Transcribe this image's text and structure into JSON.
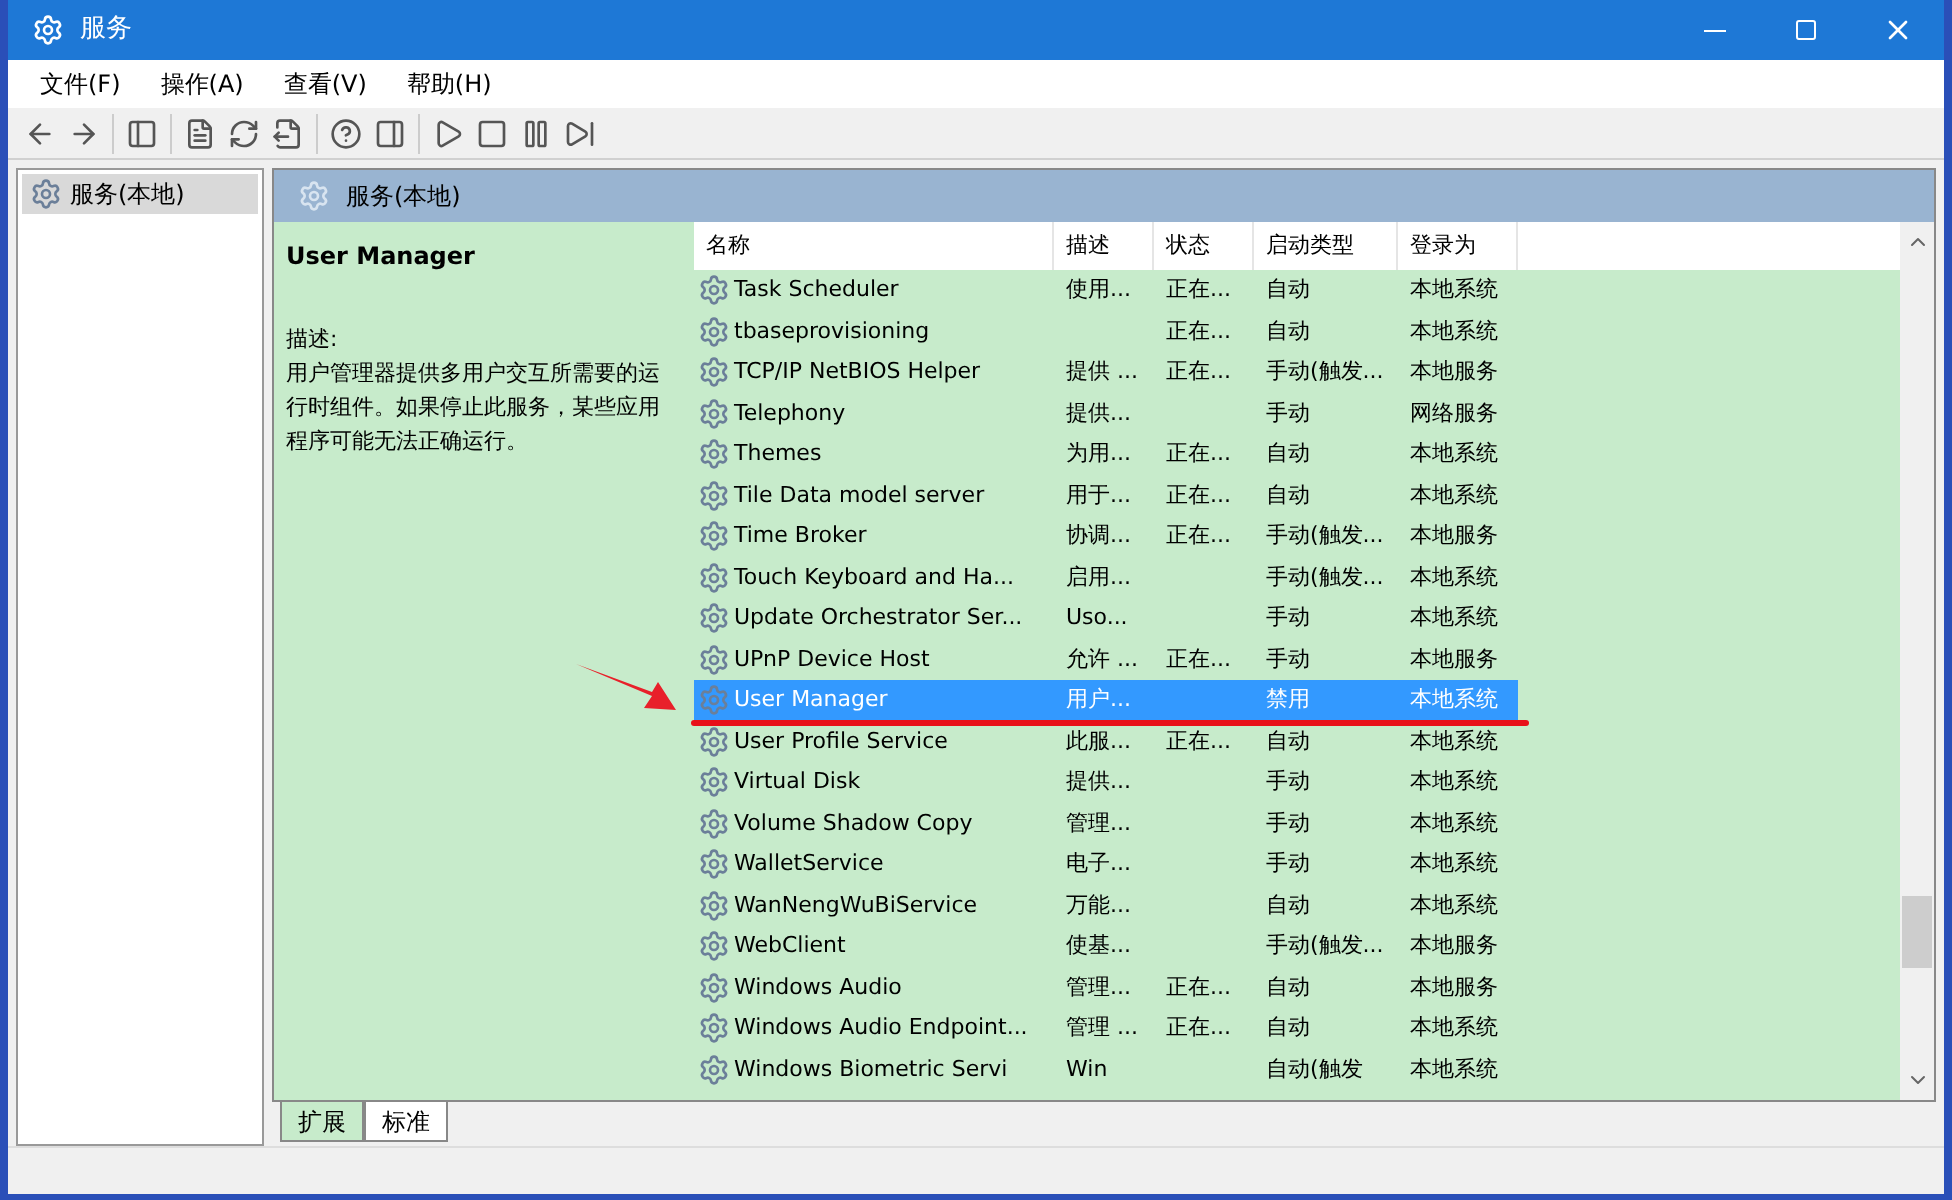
{
  "window": {
    "title": "服务"
  },
  "menu": [
    "文件(F)",
    "操作(A)",
    "查看(V)",
    "帮助(H)"
  ],
  "tree": [
    {
      "label": "服务(本地)",
      "selected": true
    }
  ],
  "pane_header": "服务(本地)",
  "detail": {
    "title": "User Manager",
    "desc_label": "描述:",
    "description": "用户管理器提供多用户交互所需要的运行时组件。如果停止此服务，某些应用程序可能无法正确运行。"
  },
  "table": {
    "columns": [
      "名称",
      "描述",
      "状态",
      "启动类型",
      "登录为"
    ],
    "rows": [
      {
        "name": "Task Scheduler",
        "desc": "使用...",
        "status": "正在...",
        "startup": "自动",
        "logon": "本地系统",
        "selected": false
      },
      {
        "name": "tbaseprovisioning",
        "desc": "",
        "status": "正在...",
        "startup": "自动",
        "logon": "本地系统",
        "selected": false
      },
      {
        "name": "TCP/IP NetBIOS Helper",
        "desc": "提供 ...",
        "status": "正在...",
        "startup": "手动(触发...",
        "logon": "本地服务",
        "selected": false
      },
      {
        "name": "Telephony",
        "desc": "提供...",
        "status": "",
        "startup": "手动",
        "logon": "网络服务",
        "selected": false
      },
      {
        "name": "Themes",
        "desc": "为用...",
        "status": "正在...",
        "startup": "自动",
        "logon": "本地系统",
        "selected": false
      },
      {
        "name": "Tile Data model server",
        "desc": "用于...",
        "status": "正在...",
        "startup": "自动",
        "logon": "本地系统",
        "selected": false
      },
      {
        "name": "Time Broker",
        "desc": "协调...",
        "status": "正在...",
        "startup": "手动(触发...",
        "logon": "本地服务",
        "selected": false
      },
      {
        "name": "Touch Keyboard and Ha...",
        "desc": "启用...",
        "status": "",
        "startup": "手动(触发...",
        "logon": "本地系统",
        "selected": false
      },
      {
        "name": "Update Orchestrator Ser...",
        "desc": "Uso...",
        "status": "",
        "startup": "手动",
        "logon": "本地系统",
        "selected": false
      },
      {
        "name": "UPnP Device Host",
        "desc": "允许 ...",
        "status": "正在...",
        "startup": "手动",
        "logon": "本地服务",
        "selected": false
      },
      {
        "name": "User Manager",
        "desc": "用户...",
        "status": "",
        "startup": "禁用",
        "logon": "本地系统",
        "selected": true
      },
      {
        "name": "User Profile Service",
        "desc": "此服...",
        "status": "正在...",
        "startup": "自动",
        "logon": "本地系统",
        "selected": false
      },
      {
        "name": "Virtual Disk",
        "desc": "提供...",
        "status": "",
        "startup": "手动",
        "logon": "本地系统",
        "selected": false
      },
      {
        "name": "Volume Shadow Copy",
        "desc": "管理...",
        "status": "",
        "startup": "手动",
        "logon": "本地系统",
        "selected": false
      },
      {
        "name": "WalletService",
        "desc": "电子...",
        "status": "",
        "startup": "手动",
        "logon": "本地系统",
        "selected": false
      },
      {
        "name": "WanNengWuBiService",
        "desc": "万能...",
        "status": "",
        "startup": "自动",
        "logon": "本地系统",
        "selected": false
      },
      {
        "name": "WebClient",
        "desc": "使基...",
        "status": "",
        "startup": "手动(触发...",
        "logon": "本地服务",
        "selected": false
      },
      {
        "name": "Windows Audio",
        "desc": "管理...",
        "status": "正在...",
        "startup": "自动",
        "logon": "本地服务",
        "selected": false
      },
      {
        "name": "Windows Audio Endpoint...",
        "desc": "管理 ...",
        "status": "正在...",
        "startup": "自动",
        "logon": "本地系统",
        "selected": false
      },
      {
        "name": "Windows Biometric Servi",
        "desc": "Win",
        "status": "",
        "startup": "自动(触发",
        "logon": "本地系统",
        "selected": false
      }
    ]
  },
  "tabs": [
    {
      "label": "扩展",
      "selected": true
    },
    {
      "label": "标准",
      "selected": false
    }
  ]
}
